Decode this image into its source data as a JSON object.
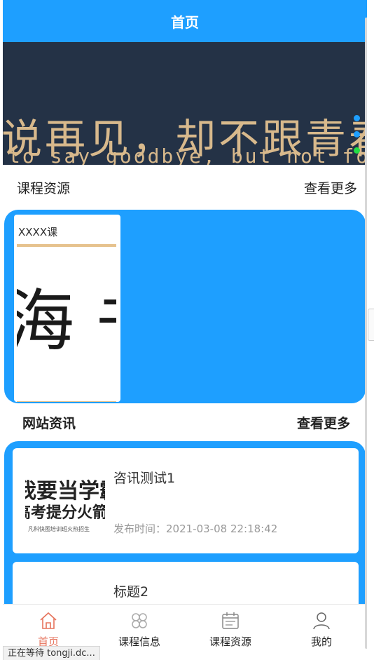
{
  "header": {
    "title": "首页"
  },
  "banner": {
    "line1": "说再见，却不跟青春",
    "line2": "to say goodbye, but not forev",
    "dot_colors": [
      "#1e9fff",
      "#1e9fff",
      "#22dd44"
    ]
  },
  "courses": {
    "title": "课程资源",
    "more": "查看更多",
    "items": [
      {
        "title": "XXXX课",
        "image_text": "海 书"
      }
    ]
  },
  "news": {
    "title": "网站资讯",
    "more": "查看更多",
    "items": [
      {
        "title": "咨讯测试1",
        "time": "发布时间：2021-03-08 22:18:42",
        "thumb_line1": "我要当学霸",
        "thumb_line2": "高考提分火箭",
        "thumb_line3": "凡科快图培训班火热招生"
      },
      {
        "title": "标题2"
      }
    ]
  },
  "tabbar": {
    "items": [
      {
        "label": "首页",
        "icon": "home-icon",
        "active": true
      },
      {
        "label": "课程信息",
        "icon": "grid-icon"
      },
      {
        "label": "课程资源",
        "icon": "calendar-icon"
      },
      {
        "label": "我的",
        "icon": "user-icon"
      }
    ]
  },
  "status_bar": {
    "text": "正在等待 tongji.dc..."
  },
  "colors": {
    "primary": "#1e9fff",
    "active_tab": "#e6735c"
  }
}
